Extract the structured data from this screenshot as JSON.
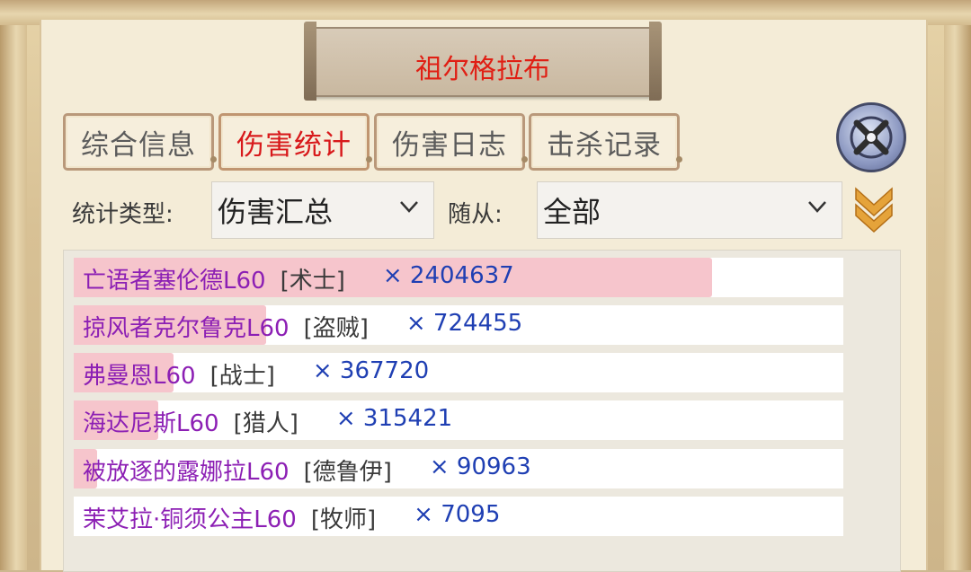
{
  "title": "祖尔格拉布",
  "tabs": [
    {
      "label": "综合信息",
      "active": false
    },
    {
      "label": "伤害统计",
      "active": true
    },
    {
      "label": "伤害日志",
      "active": false
    },
    {
      "label": "击杀记录",
      "active": false
    }
  ],
  "filters": {
    "stat_type_label": "统计类型:",
    "stat_type_value": "伤害汇总",
    "follower_label": "随从:",
    "follower_value": "全部"
  },
  "rows": [
    {
      "name": "亡语者塞伦德L60",
      "class": "[术士]",
      "value": "× 2404637",
      "fraction": 0.83
    },
    {
      "name": "掠风者克尔鲁克L60",
      "class": "[盗贼]",
      "value": "× 724455",
      "fraction": 0.25
    },
    {
      "name": "弗曼恩L60",
      "class": "[战士]",
      "value": "× 367720",
      "fraction": 0.13
    },
    {
      "name": "海达尼斯L60",
      "class": "[猎人]",
      "value": "× 315421",
      "fraction": 0.11
    },
    {
      "name": "被放逐的露娜拉L60",
      "class": "[德鲁伊]",
      "value": "× 90963",
      "fraction": 0.03
    },
    {
      "name": "茉艾拉·铜须公主L60",
      "class": "[牧师]",
      "value": "× 7095",
      "fraction": 0.0
    }
  ],
  "colors": {
    "title": "#e01f14",
    "active_tab": "#d8191b",
    "name": "#8c1fb4",
    "value": "#1f3fb3",
    "bar": "#f6c5cc"
  },
  "icons": {
    "close": "close-icon",
    "dropdown": "chevron-down-icon",
    "expand": "double-chevron-down-icon"
  }
}
